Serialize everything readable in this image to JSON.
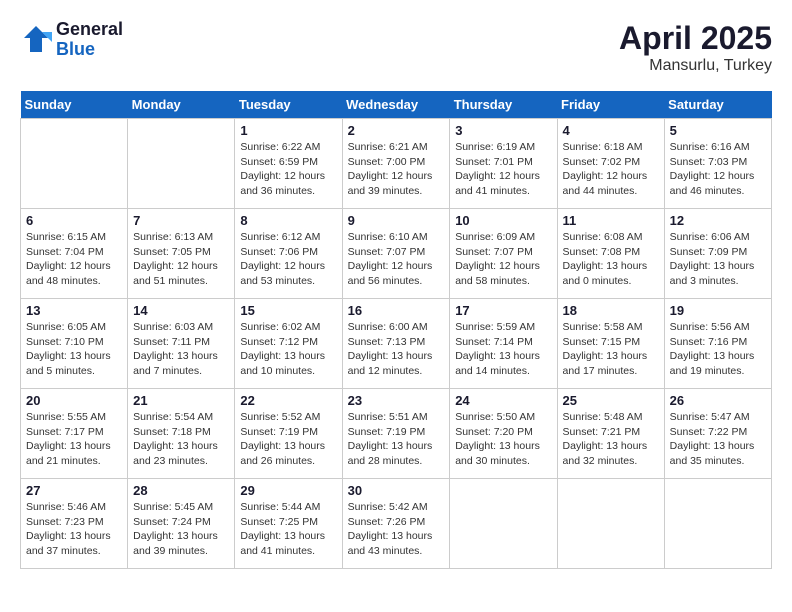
{
  "logo": {
    "general": "General",
    "blue": "Blue"
  },
  "title": {
    "month_year": "April 2025",
    "location": "Mansurlu, Turkey"
  },
  "weekdays": [
    "Sunday",
    "Monday",
    "Tuesday",
    "Wednesday",
    "Thursday",
    "Friday",
    "Saturday"
  ],
  "weeks": [
    [
      null,
      null,
      {
        "day": 1,
        "sunrise": "6:22 AM",
        "sunset": "6:59 PM",
        "daylight": "12 hours and 36 minutes."
      },
      {
        "day": 2,
        "sunrise": "6:21 AM",
        "sunset": "7:00 PM",
        "daylight": "12 hours and 39 minutes."
      },
      {
        "day": 3,
        "sunrise": "6:19 AM",
        "sunset": "7:01 PM",
        "daylight": "12 hours and 41 minutes."
      },
      {
        "day": 4,
        "sunrise": "6:18 AM",
        "sunset": "7:02 PM",
        "daylight": "12 hours and 44 minutes."
      },
      {
        "day": 5,
        "sunrise": "6:16 AM",
        "sunset": "7:03 PM",
        "daylight": "12 hours and 46 minutes."
      }
    ],
    [
      {
        "day": 6,
        "sunrise": "6:15 AM",
        "sunset": "7:04 PM",
        "daylight": "12 hours and 48 minutes."
      },
      {
        "day": 7,
        "sunrise": "6:13 AM",
        "sunset": "7:05 PM",
        "daylight": "12 hours and 51 minutes."
      },
      {
        "day": 8,
        "sunrise": "6:12 AM",
        "sunset": "7:06 PM",
        "daylight": "12 hours and 53 minutes."
      },
      {
        "day": 9,
        "sunrise": "6:10 AM",
        "sunset": "7:07 PM",
        "daylight": "12 hours and 56 minutes."
      },
      {
        "day": 10,
        "sunrise": "6:09 AM",
        "sunset": "7:07 PM",
        "daylight": "12 hours and 58 minutes."
      },
      {
        "day": 11,
        "sunrise": "6:08 AM",
        "sunset": "7:08 PM",
        "daylight": "13 hours and 0 minutes."
      },
      {
        "day": 12,
        "sunrise": "6:06 AM",
        "sunset": "7:09 PM",
        "daylight": "13 hours and 3 minutes."
      }
    ],
    [
      {
        "day": 13,
        "sunrise": "6:05 AM",
        "sunset": "7:10 PM",
        "daylight": "13 hours and 5 minutes."
      },
      {
        "day": 14,
        "sunrise": "6:03 AM",
        "sunset": "7:11 PM",
        "daylight": "13 hours and 7 minutes."
      },
      {
        "day": 15,
        "sunrise": "6:02 AM",
        "sunset": "7:12 PM",
        "daylight": "13 hours and 10 minutes."
      },
      {
        "day": 16,
        "sunrise": "6:00 AM",
        "sunset": "7:13 PM",
        "daylight": "13 hours and 12 minutes."
      },
      {
        "day": 17,
        "sunrise": "5:59 AM",
        "sunset": "7:14 PM",
        "daylight": "13 hours and 14 minutes."
      },
      {
        "day": 18,
        "sunrise": "5:58 AM",
        "sunset": "7:15 PM",
        "daylight": "13 hours and 17 minutes."
      },
      {
        "day": 19,
        "sunrise": "5:56 AM",
        "sunset": "7:16 PM",
        "daylight": "13 hours and 19 minutes."
      }
    ],
    [
      {
        "day": 20,
        "sunrise": "5:55 AM",
        "sunset": "7:17 PM",
        "daylight": "13 hours and 21 minutes."
      },
      {
        "day": 21,
        "sunrise": "5:54 AM",
        "sunset": "7:18 PM",
        "daylight": "13 hours and 23 minutes."
      },
      {
        "day": 22,
        "sunrise": "5:52 AM",
        "sunset": "7:19 PM",
        "daylight": "13 hours and 26 minutes."
      },
      {
        "day": 23,
        "sunrise": "5:51 AM",
        "sunset": "7:19 PM",
        "daylight": "13 hours and 28 minutes."
      },
      {
        "day": 24,
        "sunrise": "5:50 AM",
        "sunset": "7:20 PM",
        "daylight": "13 hours and 30 minutes."
      },
      {
        "day": 25,
        "sunrise": "5:48 AM",
        "sunset": "7:21 PM",
        "daylight": "13 hours and 32 minutes."
      },
      {
        "day": 26,
        "sunrise": "5:47 AM",
        "sunset": "7:22 PM",
        "daylight": "13 hours and 35 minutes."
      }
    ],
    [
      {
        "day": 27,
        "sunrise": "5:46 AM",
        "sunset": "7:23 PM",
        "daylight": "13 hours and 37 minutes."
      },
      {
        "day": 28,
        "sunrise": "5:45 AM",
        "sunset": "7:24 PM",
        "daylight": "13 hours and 39 minutes."
      },
      {
        "day": 29,
        "sunrise": "5:44 AM",
        "sunset": "7:25 PM",
        "daylight": "13 hours and 41 minutes."
      },
      {
        "day": 30,
        "sunrise": "5:42 AM",
        "sunset": "7:26 PM",
        "daylight": "13 hours and 43 minutes."
      },
      null,
      null,
      null
    ]
  ]
}
